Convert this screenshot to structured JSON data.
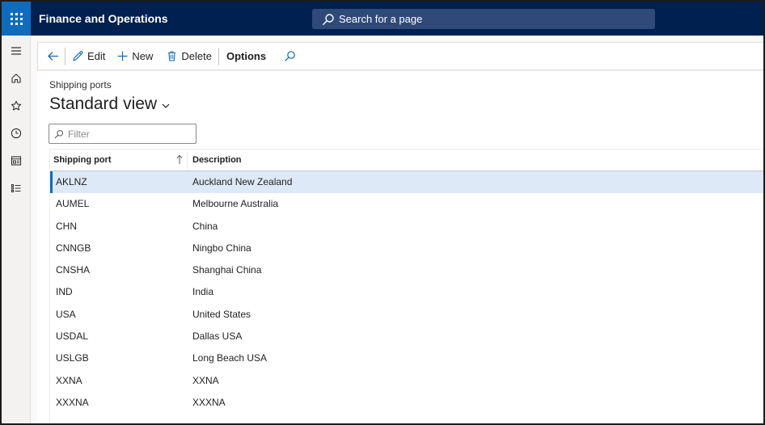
{
  "app": {
    "title": "Finance and Operations"
  },
  "search": {
    "placeholder": "Search for a page"
  },
  "toolbar": {
    "edit_label": "Edit",
    "new_label": "New",
    "delete_label": "Delete",
    "options_label": "Options"
  },
  "page": {
    "caption": "Shipping ports",
    "view_name": "Standard view"
  },
  "filter": {
    "placeholder": "Filter"
  },
  "grid": {
    "columns": [
      "Shipping port",
      "Description"
    ],
    "rows": [
      {
        "port": "AKLNZ",
        "description": "Auckland New Zealand"
      },
      {
        "port": "AUMEL",
        "description": "Melbourne Australia"
      },
      {
        "port": "CHN",
        "description": "China"
      },
      {
        "port": "CNNGB",
        "description": "Ningbo China"
      },
      {
        "port": "CNSHA",
        "description": "Shanghai China"
      },
      {
        "port": "IND",
        "description": "India"
      },
      {
        "port": "USA",
        "description": "United States"
      },
      {
        "port": "USDAL",
        "description": "Dallas USA"
      },
      {
        "port": "USLGB",
        "description": "Long Beach USA"
      },
      {
        "port": "XXNA",
        "description": "XXNA"
      },
      {
        "port": "XXXNA",
        "description": "XXXNA"
      }
    ]
  },
  "colors": {
    "header_bg": "#002050",
    "accent": "#0f6cbd",
    "selected_row": "#dde9f7"
  },
  "icons": [
    "waffle-icon",
    "search-icon",
    "hamburger-icon",
    "home-icon",
    "star-icon",
    "clock-icon",
    "workspace-icon",
    "list-icon",
    "back-arrow-icon",
    "pencil-icon",
    "plus-icon",
    "trash-icon",
    "filter-search-icon",
    "sort-ascending-icon",
    "chevron-down-icon"
  ]
}
